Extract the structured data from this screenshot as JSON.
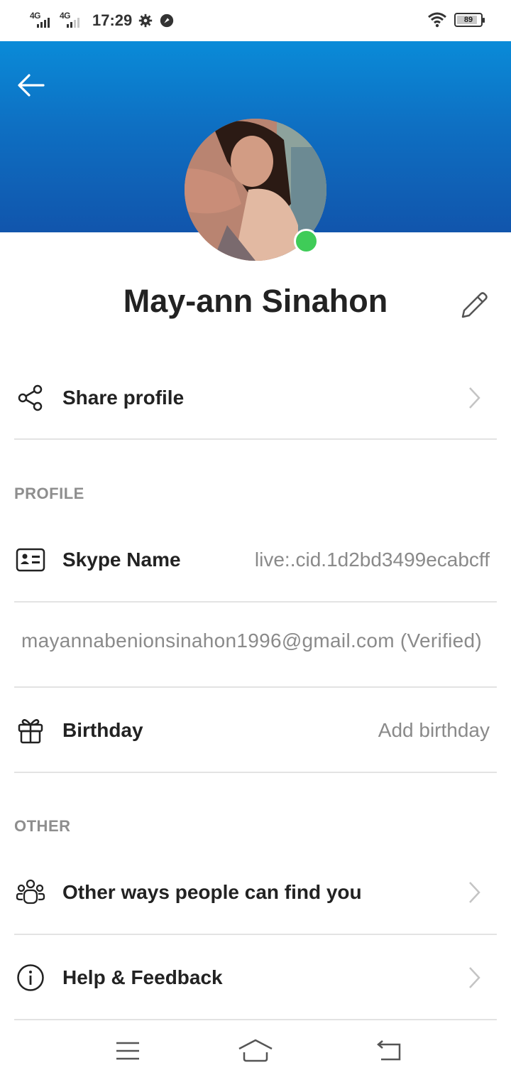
{
  "status_bar": {
    "network1": "4G",
    "network2": "4G",
    "time": "17:29",
    "battery": "89",
    "battery_level": 0.89
  },
  "profile": {
    "name": "May-ann Sinahon",
    "online": true
  },
  "share": {
    "label": "Share profile"
  },
  "sections": {
    "profile": "PROFILE",
    "other": "OTHER"
  },
  "skype_name": {
    "label": "Skype Name",
    "value": "live:.cid.1d2bd3499ecabcff"
  },
  "email": {
    "value": "mayannabenionsinahon1996@gmail.com (Verified)"
  },
  "birthday": {
    "label": "Birthday",
    "value": "Add birthday"
  },
  "other_ways": {
    "label": "Other ways people can find you"
  },
  "help": {
    "label": "Help & Feedback"
  },
  "colors": {
    "header_top": "#0a8bd8",
    "header_bottom": "#1155ac",
    "presence": "#3fcc58"
  }
}
